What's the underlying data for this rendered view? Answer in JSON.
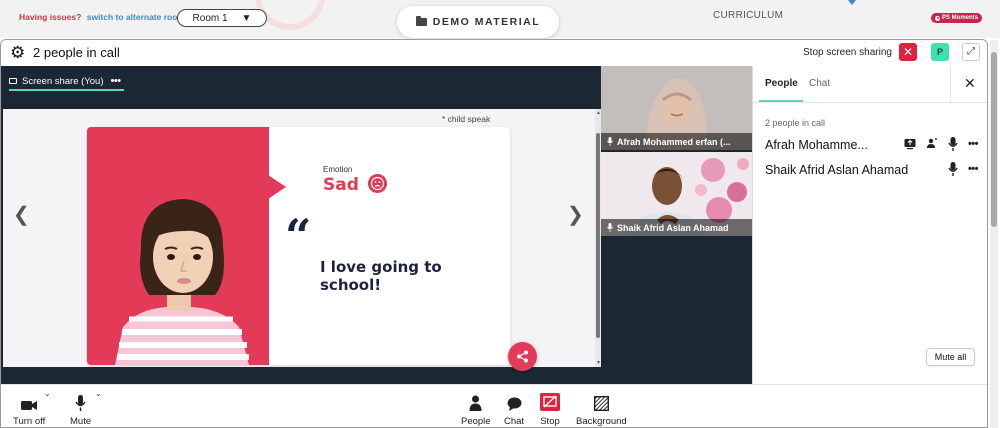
{
  "topbar": {
    "having_issues": "Having issues?",
    "alternate_room": "switch to alternate room",
    "room_select": "Room 1",
    "demo_material": "DEMO MATERIAL",
    "curriculum": "CURRICULUM",
    "ps_moments": "PS Moments"
  },
  "call_header": {
    "people_in_call": "2 people in call",
    "stop_screen_sharing": "Stop screen sharing",
    "avatar_letter": "P"
  },
  "share": {
    "tab_label": "Screen share (You)",
    "slide": {
      "note": "* child speak",
      "emotion_label": "Emotion",
      "emotion_value": "Sad",
      "quote": "I love going to school!"
    }
  },
  "video_tiles": [
    {
      "name": "Afrah Mohammed erfan (..."
    },
    {
      "name": "Shaik Afrid Aslan Ahamad"
    }
  ],
  "people_panel": {
    "tabs": [
      "People",
      "Chat"
    ],
    "count": "2 people in call",
    "people": [
      {
        "name": "Afrah Mohamme..."
      },
      {
        "name": "Shaik Afrid Aslan Ahamad"
      }
    ],
    "mute_all": "Mute all"
  },
  "toolbar": {
    "turn_off": "Turn off",
    "mute": "Mute",
    "people": "People",
    "chat": "Chat",
    "stop": "Stop",
    "background": "Background"
  },
  "colors": {
    "accent_red": "#e23a57",
    "accent_teal": "#5ad6c2",
    "stage_dark": "#1b2733",
    "link_blue": "#3b8bd1"
  }
}
